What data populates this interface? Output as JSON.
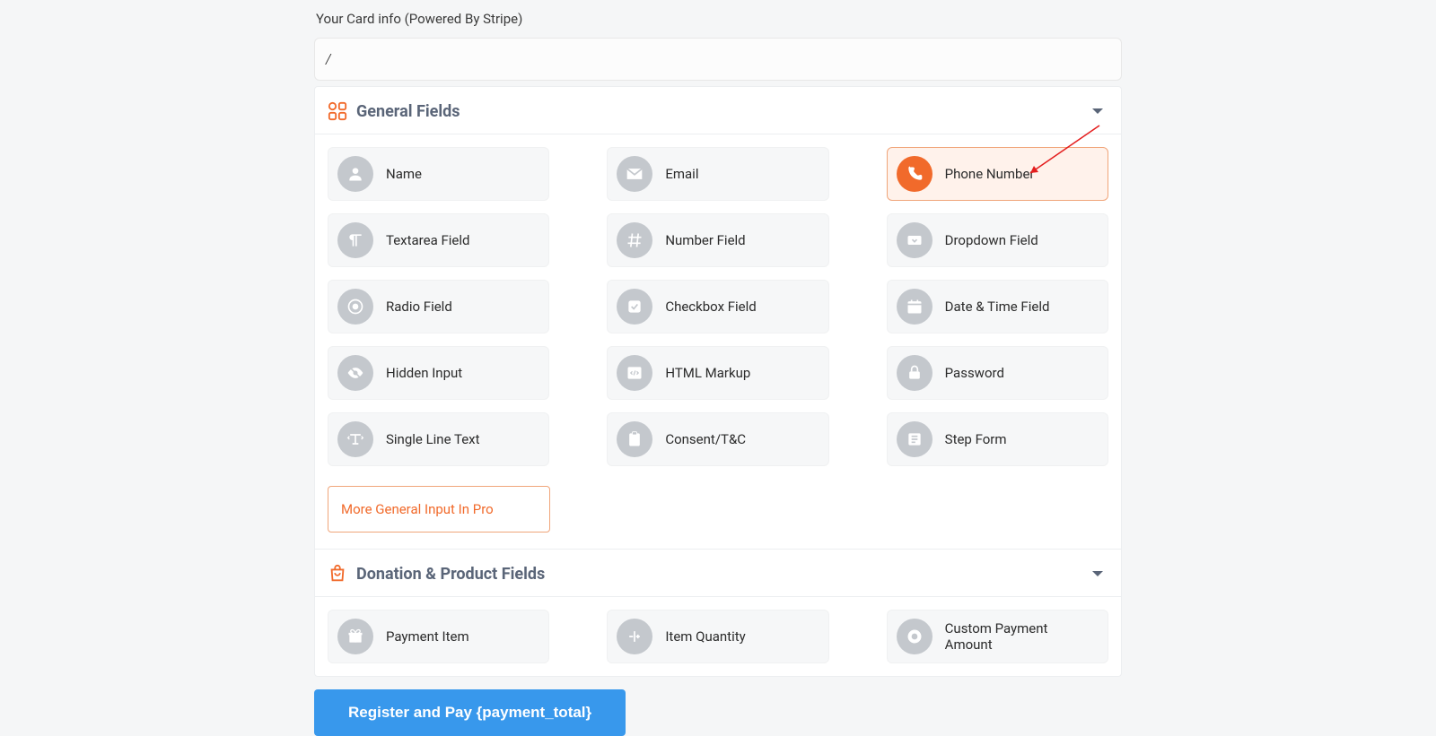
{
  "header": {
    "title": "Your Card info (Powered By Stripe)"
  },
  "card_input_value": "/",
  "sections": {
    "general": {
      "title": "General Fields",
      "items": [
        {
          "label": "Name"
        },
        {
          "label": "Email"
        },
        {
          "label": "Phone Number",
          "highlight": true
        },
        {
          "label": "Textarea Field"
        },
        {
          "label": "Number Field"
        },
        {
          "label": "Dropdown Field"
        },
        {
          "label": "Radio Field"
        },
        {
          "label": "Checkbox Field"
        },
        {
          "label": "Date & Time Field"
        },
        {
          "label": "Hidden Input"
        },
        {
          "label": "HTML Markup"
        },
        {
          "label": "Password"
        },
        {
          "label": "Single Line Text"
        },
        {
          "label": "Consent/T&C"
        },
        {
          "label": "Step Form"
        }
      ],
      "pro_link": "More General Input In Pro"
    },
    "donation": {
      "title": "Donation & Product Fields",
      "items": [
        {
          "label": "Payment Item"
        },
        {
          "label": "Item Quantity"
        },
        {
          "label": "Custom Payment Amount"
        }
      ]
    }
  },
  "submit": {
    "label": "Register and Pay {payment_total}"
  }
}
